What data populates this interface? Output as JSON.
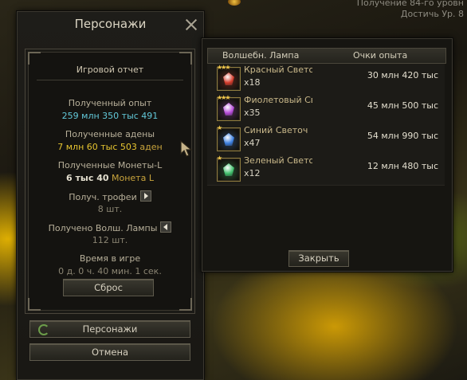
{
  "top_info": {
    "line1": "Получение 84-го уровн",
    "line2": "Достичь Ур. 8"
  },
  "panel": {
    "title": "Персонажи",
    "report_title": "Игровой отчет",
    "stats": [
      {
        "label": "Полученный опыт",
        "value": "259 млн 350 тыс 491"
      },
      {
        "label": "Полученные адены",
        "value": "7 млн 60 тыс 503",
        "unit": "аден"
      },
      {
        "label": "Полученные Монеты-L",
        "value": "6 тыс 40",
        "unit": "Монета L"
      },
      {
        "label": "Получ. трофеи",
        "value": "8 шт."
      },
      {
        "label": "Получено Волш. Лампы",
        "value": "112 шт."
      },
      {
        "label": "Время в игре",
        "value": "0 д. 0 ч. 40 мин. 1 сек."
      }
    ],
    "reset_label": "Сброс",
    "characters_label": "Персонажи",
    "cancel_label": "Отмена"
  },
  "lamps": {
    "col_lamp": "Волшебн. Лампа",
    "col_xp": "Очки опыта",
    "rows": [
      {
        "name": "Красный Светоч",
        "qty": "x18",
        "xp": "30 млн 420 тыс",
        "color": "#d33a2a",
        "stars": "★★★"
      },
      {
        "name": "Фиолетовый Светоч",
        "qty": "x35",
        "xp": "45 млн 500 тыс",
        "color": "#b54ad8",
        "stars": "★★★"
      },
      {
        "name": "Синий Светоч",
        "qty": "x47",
        "xp": "54 млн 990 тыс",
        "color": "#3b7fe0",
        "stars": "★"
      },
      {
        "name": "Зеленый Светоч",
        "qty": "x12",
        "xp": "12 млн 480 тыс",
        "color": "#3fbf6a",
        "stars": "★"
      }
    ],
    "close_label": "Закрыть"
  }
}
